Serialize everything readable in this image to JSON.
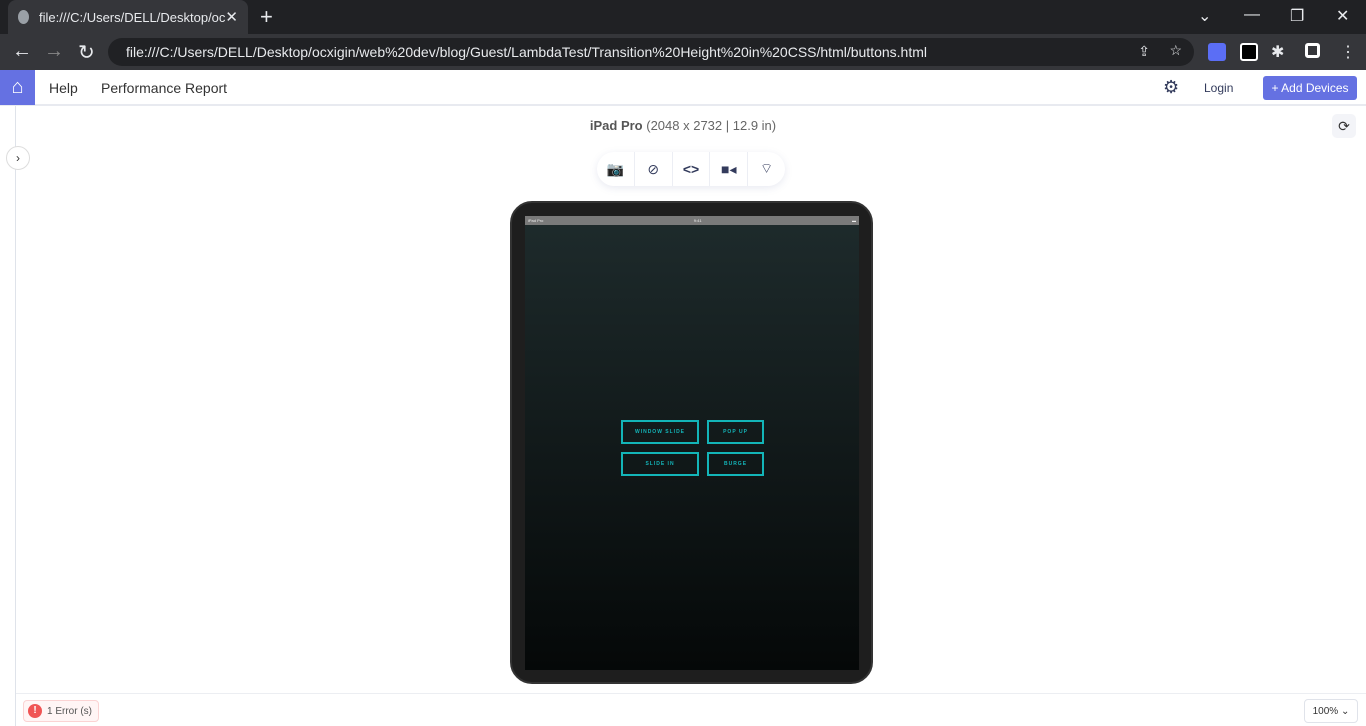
{
  "browser": {
    "tab_title": "file:///C:/Users/DELL/Desktop/oc",
    "url": "file:///C:/Users/DELL/Desktop/ocxigin/web%20dev/blog/Guest/LambdaTest/Transition%20Height%20in%20CSS/html/buttons.html"
  },
  "appbar": {
    "help": "Help",
    "performance": "Performance Report",
    "login": "Login",
    "add_devices": "+ Add Devices"
  },
  "device": {
    "name": "iPad Pro",
    "specs": "(2048 x 2732 | 12.9 in)",
    "status_left": "iPad Pro",
    "status_time": "9:41"
  },
  "screen_buttons": [
    "WINDOW SLIDE",
    "POP UP",
    "SLIDE IN",
    "BURGE"
  ],
  "footer": {
    "errors": "1 Error (s)",
    "zoom": "100%"
  },
  "colors": {
    "accent": "#6571e2",
    "button_border": "#13b5b8",
    "error": "#f05454"
  }
}
